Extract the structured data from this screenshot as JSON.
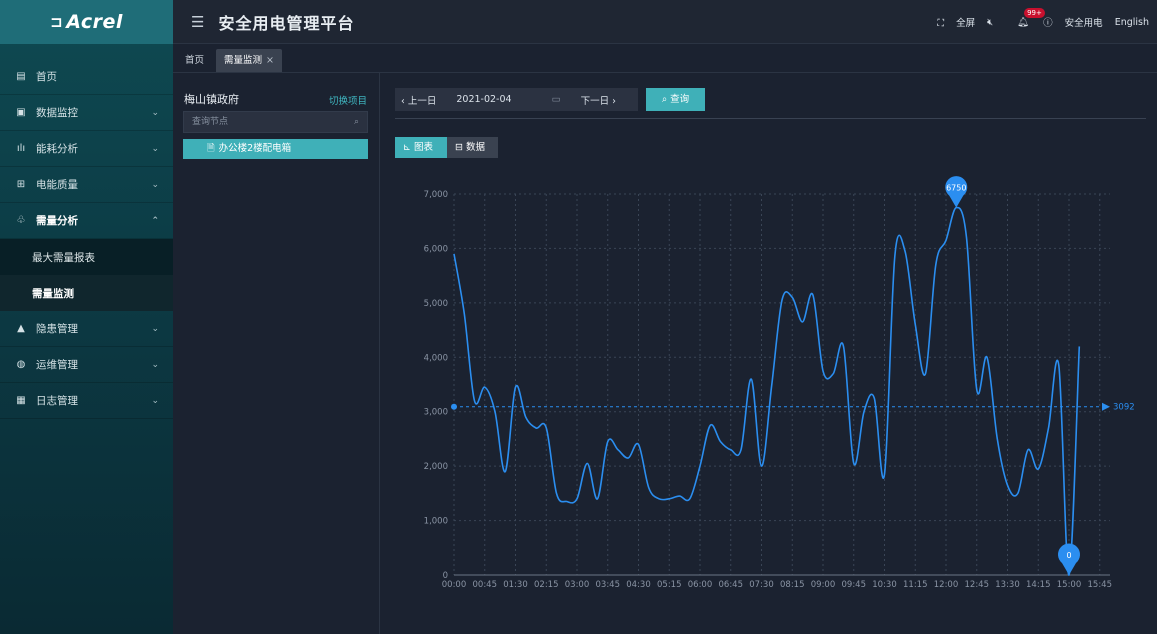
{
  "app": {
    "logo": "Acrel",
    "title": "安全用电管理平台"
  },
  "topbar": {
    "fullscreen": "全屏",
    "notif_badge": "99+",
    "user": "安全用电",
    "lang": "English"
  },
  "sidebar": {
    "items": [
      {
        "label": "首页",
        "icon": "home-icon",
        "glyph": "▤"
      },
      {
        "label": "数据监控",
        "icon": "monitor-icon",
        "glyph": "▣",
        "chev": "⌄"
      },
      {
        "label": "能耗分析",
        "icon": "bar-chart-icon",
        "glyph": "ılı",
        "chev": "⌄"
      },
      {
        "label": "电能质量",
        "icon": "calendar-icon",
        "glyph": "⊞",
        "chev": "⌄"
      },
      {
        "label": "需量分析",
        "icon": "network-icon",
        "glyph": "♧",
        "chev": "⌃",
        "open": true
      },
      {
        "label": "隐患管理",
        "icon": "warning-icon",
        "glyph": "▲",
        "chev": "⌄"
      },
      {
        "label": "运维管理",
        "icon": "globe-icon",
        "glyph": "◍",
        "chev": "⌄"
      },
      {
        "label": "日志管理",
        "icon": "log-icon",
        "glyph": "▦",
        "chev": "⌄"
      }
    ],
    "subitems": [
      {
        "label": "最大需量报表"
      },
      {
        "label": "需量监测",
        "active": true
      }
    ]
  },
  "tabs": [
    {
      "label": "首页"
    },
    {
      "label": "需量监测",
      "active": true
    }
  ],
  "left": {
    "project": "梅山镇政府",
    "switch": "切换项目",
    "search_placeholder": "查询节点",
    "node": "办公楼2楼配电箱"
  },
  "query": {
    "prev": "上一日",
    "date": "2021-02-04",
    "next": "下一日",
    "search": "查询"
  },
  "view_tabs": {
    "chart": "图表",
    "data": "数据"
  },
  "colors": {
    "accent": "#3fb0b8",
    "line": "#2b8ef0"
  },
  "chart_data": {
    "type": "line",
    "ylim": [
      0,
      7000
    ],
    "yticks": [
      0,
      1000,
      2000,
      3000,
      4000,
      5000,
      6000,
      7000
    ],
    "ytick_labels": [
      "0",
      "1,000",
      "2,000",
      "3,000",
      "4,000",
      "5,000",
      "6,000",
      "7,000"
    ],
    "xtick_labels": [
      "00:00",
      "00:45",
      "01:30",
      "02:15",
      "03:00",
      "03:45",
      "04:30",
      "05:15",
      "06:00",
      "06:45",
      "07:30",
      "08:15",
      "09:00",
      "09:45",
      "10:30",
      "11:15",
      "12:00",
      "12:45",
      "13:30",
      "14:15",
      "15:00",
      "15:45"
    ],
    "x": [
      "00:00",
      "00:15",
      "00:30",
      "00:45",
      "01:00",
      "01:15",
      "01:30",
      "01:45",
      "02:00",
      "02:15",
      "02:30",
      "02:45",
      "03:00",
      "03:15",
      "03:30",
      "03:45",
      "04:00",
      "04:15",
      "04:30",
      "04:45",
      "05:00",
      "05:15",
      "05:30",
      "05:45",
      "06:00",
      "06:15",
      "06:30",
      "06:45",
      "07:00",
      "07:15",
      "07:30",
      "07:45",
      "08:00",
      "08:15",
      "08:30",
      "08:45",
      "09:00",
      "09:15",
      "09:30",
      "09:45",
      "10:00",
      "10:15",
      "10:30",
      "10:45",
      "11:00",
      "11:15",
      "11:30",
      "11:45",
      "12:00",
      "12:15",
      "12:30",
      "12:45",
      "13:00",
      "13:15",
      "13:30",
      "13:45",
      "14:00",
      "14:15",
      "14:30",
      "14:45",
      "15:00",
      "15:15",
      "15:30",
      "15:45",
      "16:00"
    ],
    "values": [
      5900,
      4800,
      3200,
      3450,
      3000,
      1900,
      3450,
      2900,
      2700,
      2700,
      1500,
      1350,
      1400,
      2050,
      1400,
      2450,
      2300,
      2150,
      2400,
      1600,
      1400,
      1400,
      1450,
      1400,
      2000,
      2750,
      2450,
      2300,
      2300,
      3600,
      2000,
      3500,
      5050,
      5100,
      4650,
      5150,
      3750,
      3700,
      4200,
      2050,
      3000,
      3250,
      1850,
      5850,
      5950,
      4600,
      3700,
      5700,
      6150,
      6750,
      6200,
      3400,
      4000,
      2500,
      1650,
      1500,
      2300,
      1950,
      2700,
      3850,
      0,
      4200,
      null,
      null,
      null
    ],
    "max_marker": {
      "value": 6750,
      "label": "6750"
    },
    "min_marker": {
      "value": 0,
      "label": "0"
    },
    "avg_line": {
      "value": 3092,
      "label": "3092"
    }
  }
}
